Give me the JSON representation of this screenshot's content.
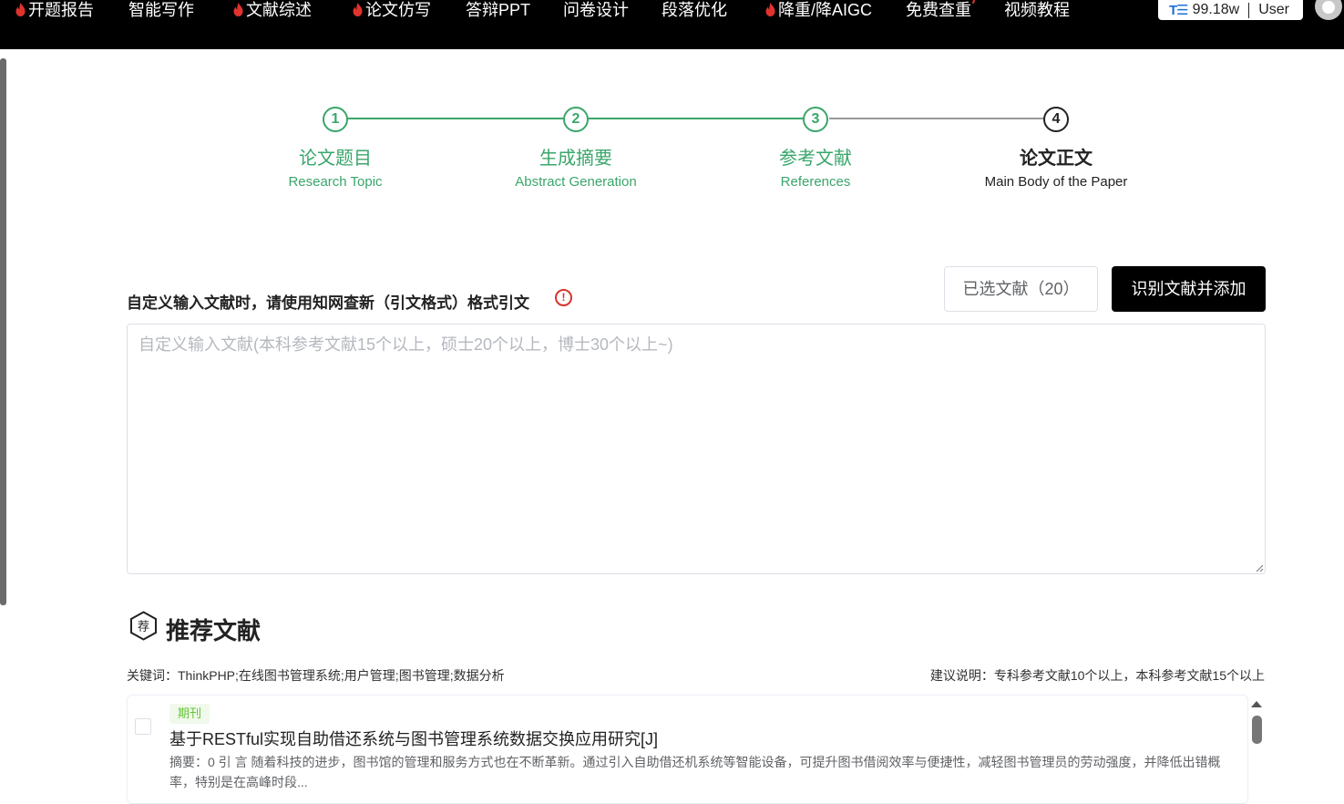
{
  "nav": {
    "items": [
      {
        "label": "开题报告",
        "hot": true
      },
      {
        "label": "智能写作",
        "hot": false
      },
      {
        "label": "文献综述",
        "hot": true
      },
      {
        "label": "论文仿写",
        "hot": true
      },
      {
        "label": "答辩PPT",
        "hot": false
      },
      {
        "label": "问卷设计",
        "hot": false
      },
      {
        "label": "段落优化",
        "hot": false
      },
      {
        "label": "降重/降AIGC",
        "hot": true
      },
      {
        "label": "免费查重",
        "hot": false
      },
      {
        "label": "视频教程",
        "hot": false
      }
    ],
    "token_icon": "T☰",
    "token_balance": "99.18w",
    "user_label": "User"
  },
  "steps": [
    {
      "num": "1",
      "title": "论文题目",
      "subtitle": "Research Topic",
      "state": "done"
    },
    {
      "num": "2",
      "title": "生成摘要",
      "subtitle": "Abstract Generation",
      "state": "done"
    },
    {
      "num": "3",
      "title": "参考文献",
      "subtitle": "References",
      "state": "done"
    },
    {
      "num": "4",
      "title": "论文正文",
      "subtitle": "Main Body of the Paper",
      "state": "active"
    }
  ],
  "custom_ref": {
    "hint": "自定义输入文献时，请使用知网查新（引文格式）格式引文",
    "hint_icon": "!",
    "selected_button": "已选文献（20）",
    "add_button": "识别文献并添加",
    "placeholder": "自定义输入文献(本科参考文献15个以上，硕士20个以上，博士30个以上~)"
  },
  "recommend": {
    "icon_char": "荐",
    "title": "推荐文献",
    "keywords": "关键词：ThinkPHP;在线图书管理系统;用户管理;图书管理;数据分析",
    "suggestion": "建议说明：专科参考文献10个以上，本科参考文献15个以上",
    "items": [
      {
        "tag": "期刊",
        "title": "基于RESTful实现自助借还系统与图书管理系统数据交换应用研究[J]",
        "abstract": "摘要：0 引 言 随着科技的进步，图书馆的管理和服务方式也在不断革新。通过引入自助借还机系统等智能设备，可提升图书借阅效率与便捷性，减轻图书管理员的劳动强度，并降低出错概率，特别是在高峰时段..."
      }
    ]
  },
  "colors": {
    "accent_green": "#3aa66b",
    "nav_bg": "#000000",
    "warning_red": "#d9342b"
  }
}
